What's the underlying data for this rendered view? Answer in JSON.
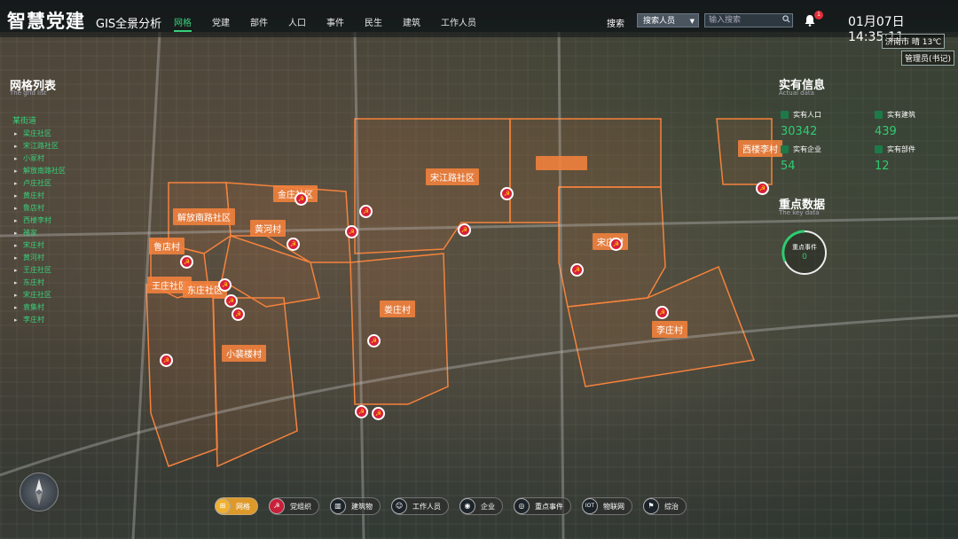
{
  "header": {
    "app_title": "智慧党建",
    "app_subtitle": "GIS全景分析",
    "nav": [
      "网格",
      "党建",
      "部件",
      "人口",
      "事件",
      "民生",
      "建筑",
      "工作人员"
    ],
    "nav_active": 0,
    "search_label": "搜索",
    "search_select": "搜索人员",
    "search_placeholder": "输入搜索",
    "notification_count": "1",
    "clock": "01月07日 14:35:11",
    "weather": "济南市 晴 13℃",
    "user_role": "管理员(书记)"
  },
  "grid_list": {
    "title": "网格列表",
    "subtitle": "The grid list",
    "root": "某街道",
    "items": [
      "梁庄社区",
      "宋江路社区",
      "小冢村",
      "解放南路社区",
      "卢庄社区",
      "黄庄村",
      "鲁店村",
      "西楼李村",
      "褚家",
      "宋庄村",
      "黄河村",
      "王庄社区",
      "东庄村",
      "宋庄社区",
      "袁集村",
      "李庄村"
    ]
  },
  "map": {
    "region_labels": [
      "解放南路社区",
      "金庄社区",
      "黄河村",
      "鲁店村",
      "王庄社区",
      "东庄社区",
      "小裴楼村",
      "宋江路社区",
      "娄庄村",
      "宋庄村",
      "李庄村",
      "西楼李村"
    ]
  },
  "actual_data": {
    "title": "实有信息",
    "subtitle": "Actual data",
    "stats": [
      {
        "label": "实有人口",
        "value": "30342"
      },
      {
        "label": "实有建筑",
        "value": "439"
      },
      {
        "label": "实有企业",
        "value": "54"
      },
      {
        "label": "实有部件",
        "value": "12"
      }
    ]
  },
  "key_data": {
    "title": "重点数据",
    "subtitle": "The key data",
    "label": "重点事件",
    "value": "0"
  },
  "toolbar": [
    {
      "label": "网格",
      "icon": "grid-icon",
      "glyph": "⊞"
    },
    {
      "label": "党组织",
      "icon": "party-icon",
      "glyph": "☭"
    },
    {
      "label": "建筑物",
      "icon": "building-icon",
      "glyph": "▥"
    },
    {
      "label": "工作人员",
      "icon": "staff-icon",
      "glyph": "☺"
    },
    {
      "label": "企业",
      "icon": "enterprise-icon",
      "glyph": "◉"
    },
    {
      "label": "重点事件",
      "icon": "event-icon",
      "glyph": "◎"
    },
    {
      "label": "物联网",
      "icon": "iot-icon",
      "glyph": "IOT"
    },
    {
      "label": "综治",
      "icon": "governance-icon",
      "glyph": "⚑"
    }
  ],
  "colors": {
    "accent": "#37d07a",
    "region": "#f5823c",
    "pin": "#d8203a"
  }
}
